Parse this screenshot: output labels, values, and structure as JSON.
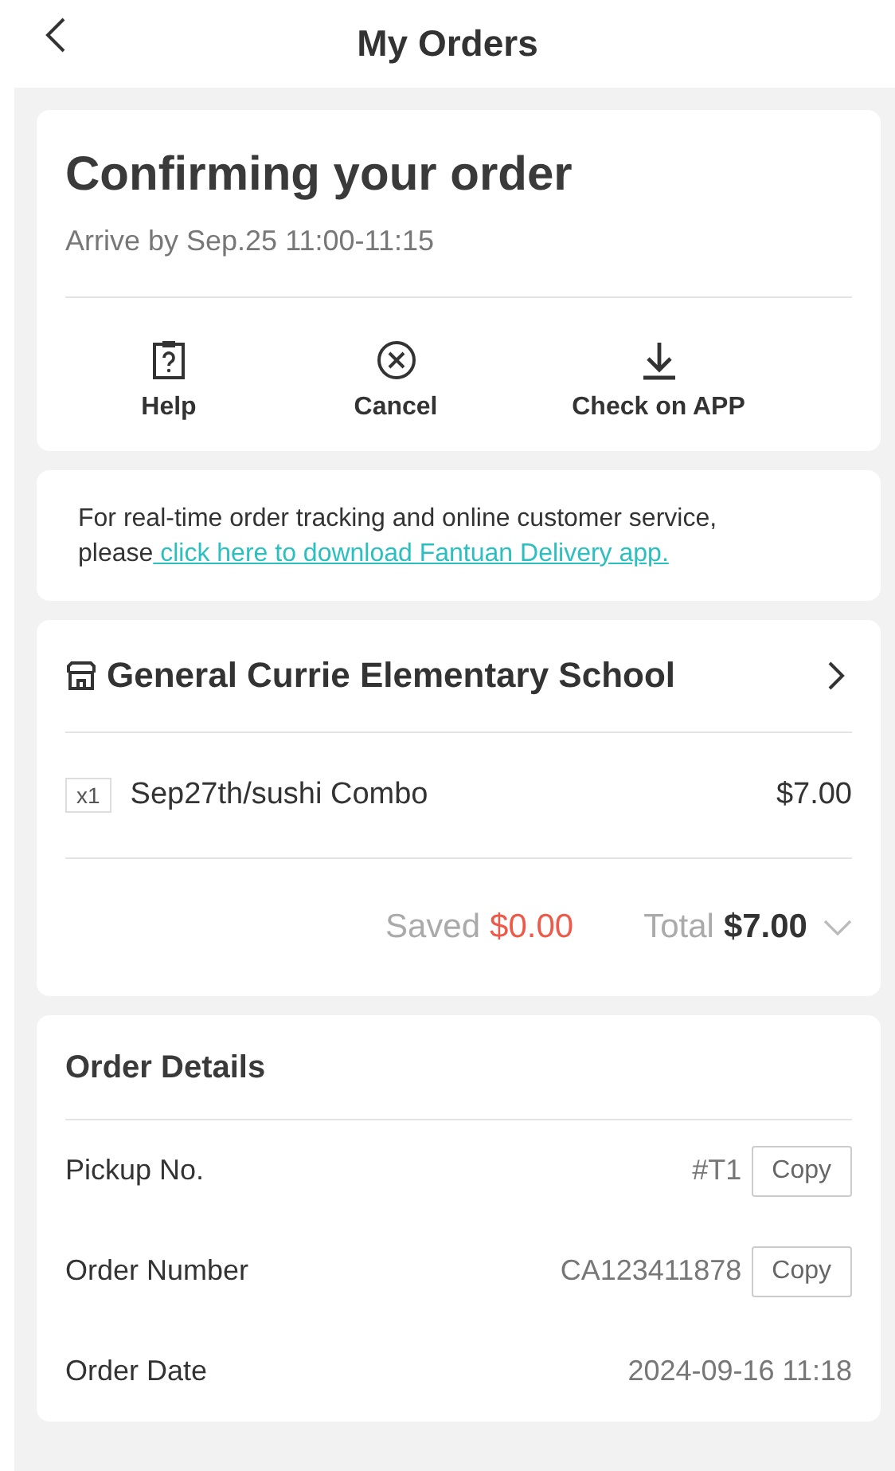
{
  "header": {
    "title": "My Orders"
  },
  "status": {
    "title": "Confirming your order",
    "arrival": "Arrive by Sep.25 11:00-11:15",
    "actions": [
      {
        "kind": "help",
        "label": "Help"
      },
      {
        "kind": "cancel",
        "label": "Cancel"
      },
      {
        "kind": "download",
        "label": "Check on APP"
      }
    ]
  },
  "notice": {
    "text": "For real-time order tracking and online customer service, please",
    "link": " click here to download Fantuan Delivery app."
  },
  "store": {
    "name": "General Currie Elementary School",
    "items": [
      {
        "qty": "x1",
        "name": "Sep27th/sushi Combo",
        "price": "$7.00"
      }
    ],
    "saved_label": "Saved",
    "saved": "$0.00",
    "total_label": "Total",
    "total": "$7.00"
  },
  "details": {
    "title": "Order Details",
    "rows": [
      {
        "label": "Pickup No.",
        "value": "#T1",
        "button": "Copy"
      },
      {
        "label": "Order Number",
        "value": "CA123411878",
        "button": "Copy"
      },
      {
        "label": "Order Date",
        "value": "2024-09-16 11:18"
      }
    ]
  }
}
